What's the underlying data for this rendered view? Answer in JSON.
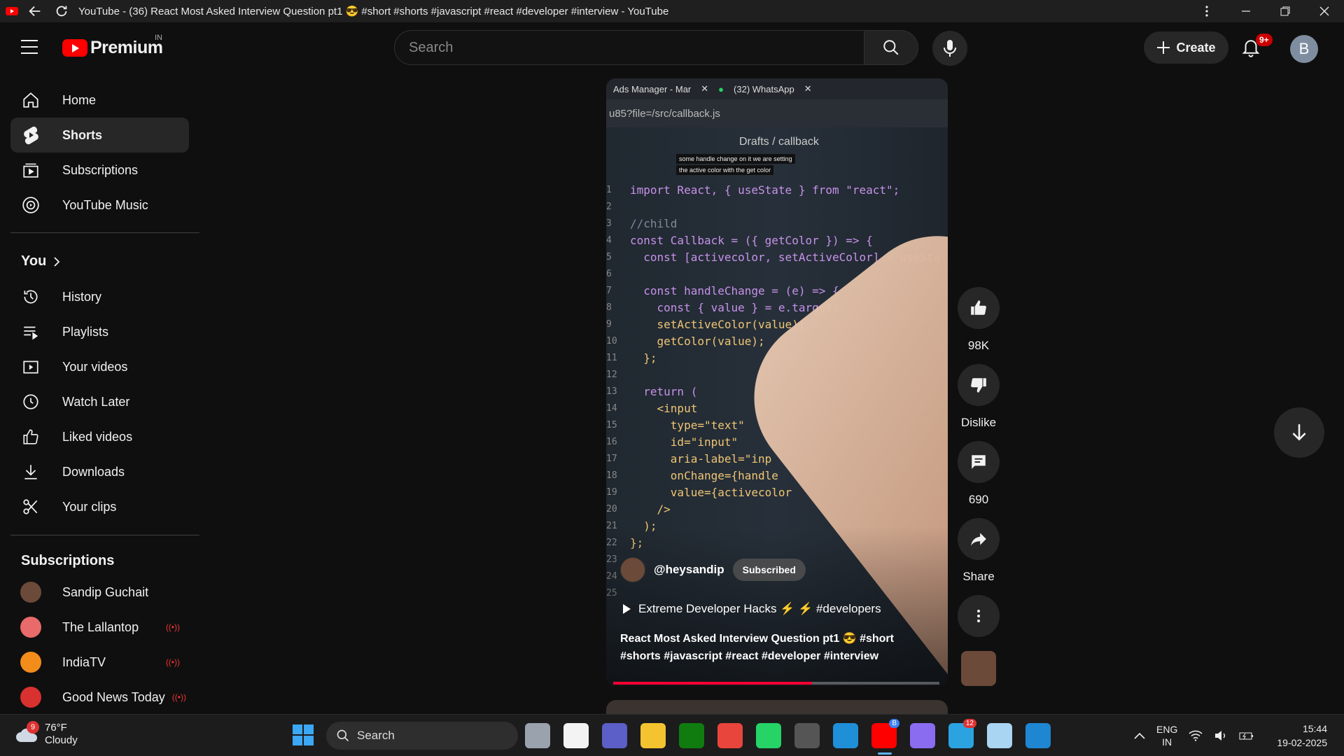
{
  "window": {
    "title": "YouTube - (36) React Most Asked Interview Question pt1 😎 #short #shorts #javascript #react #developer #interview - YouTube"
  },
  "header": {
    "logo_text": "Premium",
    "region": "IN",
    "search_placeholder": "Search",
    "create_label": "Create",
    "notifications_badge": "9+",
    "avatar_letter": "B"
  },
  "sidebar": {
    "main": [
      {
        "label": "Home",
        "icon": "home-icon"
      },
      {
        "label": "Shorts",
        "icon": "shorts-icon",
        "active": true
      },
      {
        "label": "Subscriptions",
        "icon": "subscriptions-icon"
      },
      {
        "label": "YouTube Music",
        "icon": "music-icon"
      }
    ],
    "you_heading": "You",
    "you": [
      {
        "label": "History",
        "icon": "history-icon"
      },
      {
        "label": "Playlists",
        "icon": "playlists-icon"
      },
      {
        "label": "Your videos",
        "icon": "your-videos-icon"
      },
      {
        "label": "Watch Later",
        "icon": "watch-later-icon"
      },
      {
        "label": "Liked videos",
        "icon": "like-icon"
      },
      {
        "label": "Downloads",
        "icon": "download-icon"
      },
      {
        "label": "Your clips",
        "icon": "clips-icon"
      }
    ],
    "subscriptions_heading": "Subscriptions",
    "subscriptions": [
      {
        "name": "Sandip Guchait",
        "live": false,
        "color": "#6b4a3a"
      },
      {
        "name": "The Lallantop",
        "live": true,
        "live_mark": "((•))",
        "color": "#e86a6a"
      },
      {
        "name": "IndiaTV",
        "live": true,
        "live_mark": "((•))",
        "color": "#f28c1a"
      },
      {
        "name": "Good News Today",
        "live": true,
        "live_mark": "((•))",
        "color": "#d93030"
      }
    ]
  },
  "short": {
    "browser_tabs": [
      "Ads Manager - Mar",
      "(32) WhatsApp"
    ],
    "url": "u85?file=/src/callback.js",
    "breadcrumb": "Drafts / callback",
    "caption_line1": "some handle change on it we are setting",
    "caption_line2": "the active color with the get color",
    "code_lines": [
      {
        "n": "1",
        "text": "import React, { useState } from \"react\";"
      },
      {
        "n": "2",
        "text": ""
      },
      {
        "n": "3",
        "text": "//child"
      },
      {
        "n": "4",
        "text": "const Callback = ({ getColor }) => {"
      },
      {
        "n": "5",
        "text": "  const [activecolor, setActiveColor] = useSta"
      },
      {
        "n": "6",
        "text": ""
      },
      {
        "n": "7",
        "text": "  const handleChange = (e) => {"
      },
      {
        "n": "8",
        "text": "    const { value } = e.target;"
      },
      {
        "n": "9",
        "text": "    setActiveColor(value);"
      },
      {
        "n": "10",
        "text": "    getColor(value);"
      },
      {
        "n": "11",
        "text": "  };"
      },
      {
        "n": "12",
        "text": ""
      },
      {
        "n": "13",
        "text": "  return ("
      },
      {
        "n": "14",
        "text": "    <input"
      },
      {
        "n": "15",
        "text": "      type=\"text\""
      },
      {
        "n": "16",
        "text": "      id=\"input\""
      },
      {
        "n": "17",
        "text": "      aria-label=\"inp"
      },
      {
        "n": "18",
        "text": "      onChange={handle"
      },
      {
        "n": "19",
        "text": "      value={activecolor"
      },
      {
        "n": "20",
        "text": "    />"
      },
      {
        "n": "21",
        "text": "  );"
      },
      {
        "n": "22",
        "text": "};"
      },
      {
        "n": "23",
        "text": ""
      },
      {
        "n": "24",
        "text": ""
      },
      {
        "n": "25",
        "text": ""
      }
    ],
    "channel_handle": "@heysandip",
    "subscribed_label": "Subscribed",
    "playlist_label": "Extreme Developer Hacks ⚡ ⚡ #developers",
    "title": "React Most Asked Interview Question pt1 😎 #short #shorts #javascript #react #developer #interview",
    "progress": 0.61
  },
  "actions": {
    "likes": "98K",
    "dislike_label": "Dislike",
    "comments": "690",
    "share_label": "Share"
  },
  "taskbar": {
    "weather_temp": "76°F",
    "weather_desc": "Cloudy",
    "weather_badge": "9",
    "search_label": "Search",
    "lang_top": "ENG",
    "lang_bottom": "IN",
    "time": "15:44",
    "date": "19-02-2025",
    "apps": [
      {
        "name": "task-view",
        "color": "#9aa3ad"
      },
      {
        "name": "microsoft-store",
        "color": "#f3f3f3"
      },
      {
        "name": "teams",
        "color": "#5b5fc7"
      },
      {
        "name": "file-explorer",
        "color": "#f4c430"
      },
      {
        "name": "xbox",
        "color": "#107c10"
      },
      {
        "name": "chrome",
        "color": "#e8453c"
      },
      {
        "name": "whatsapp",
        "color": "#25d366"
      },
      {
        "name": "avatar-app",
        "color": "#555"
      },
      {
        "name": "edge",
        "color": "#1f8fd8"
      },
      {
        "name": "youtube",
        "color": "#ff0000"
      },
      {
        "name": "copilot",
        "color": "#8a6cf0"
      },
      {
        "name": "telegram",
        "color": "#2aa3e0"
      },
      {
        "name": "remote-desktop",
        "color": "#a9d4f2"
      },
      {
        "name": "vscode",
        "color": "#1f86d1"
      }
    ],
    "youtube_badge": "B",
    "telegram_badge": "12"
  }
}
